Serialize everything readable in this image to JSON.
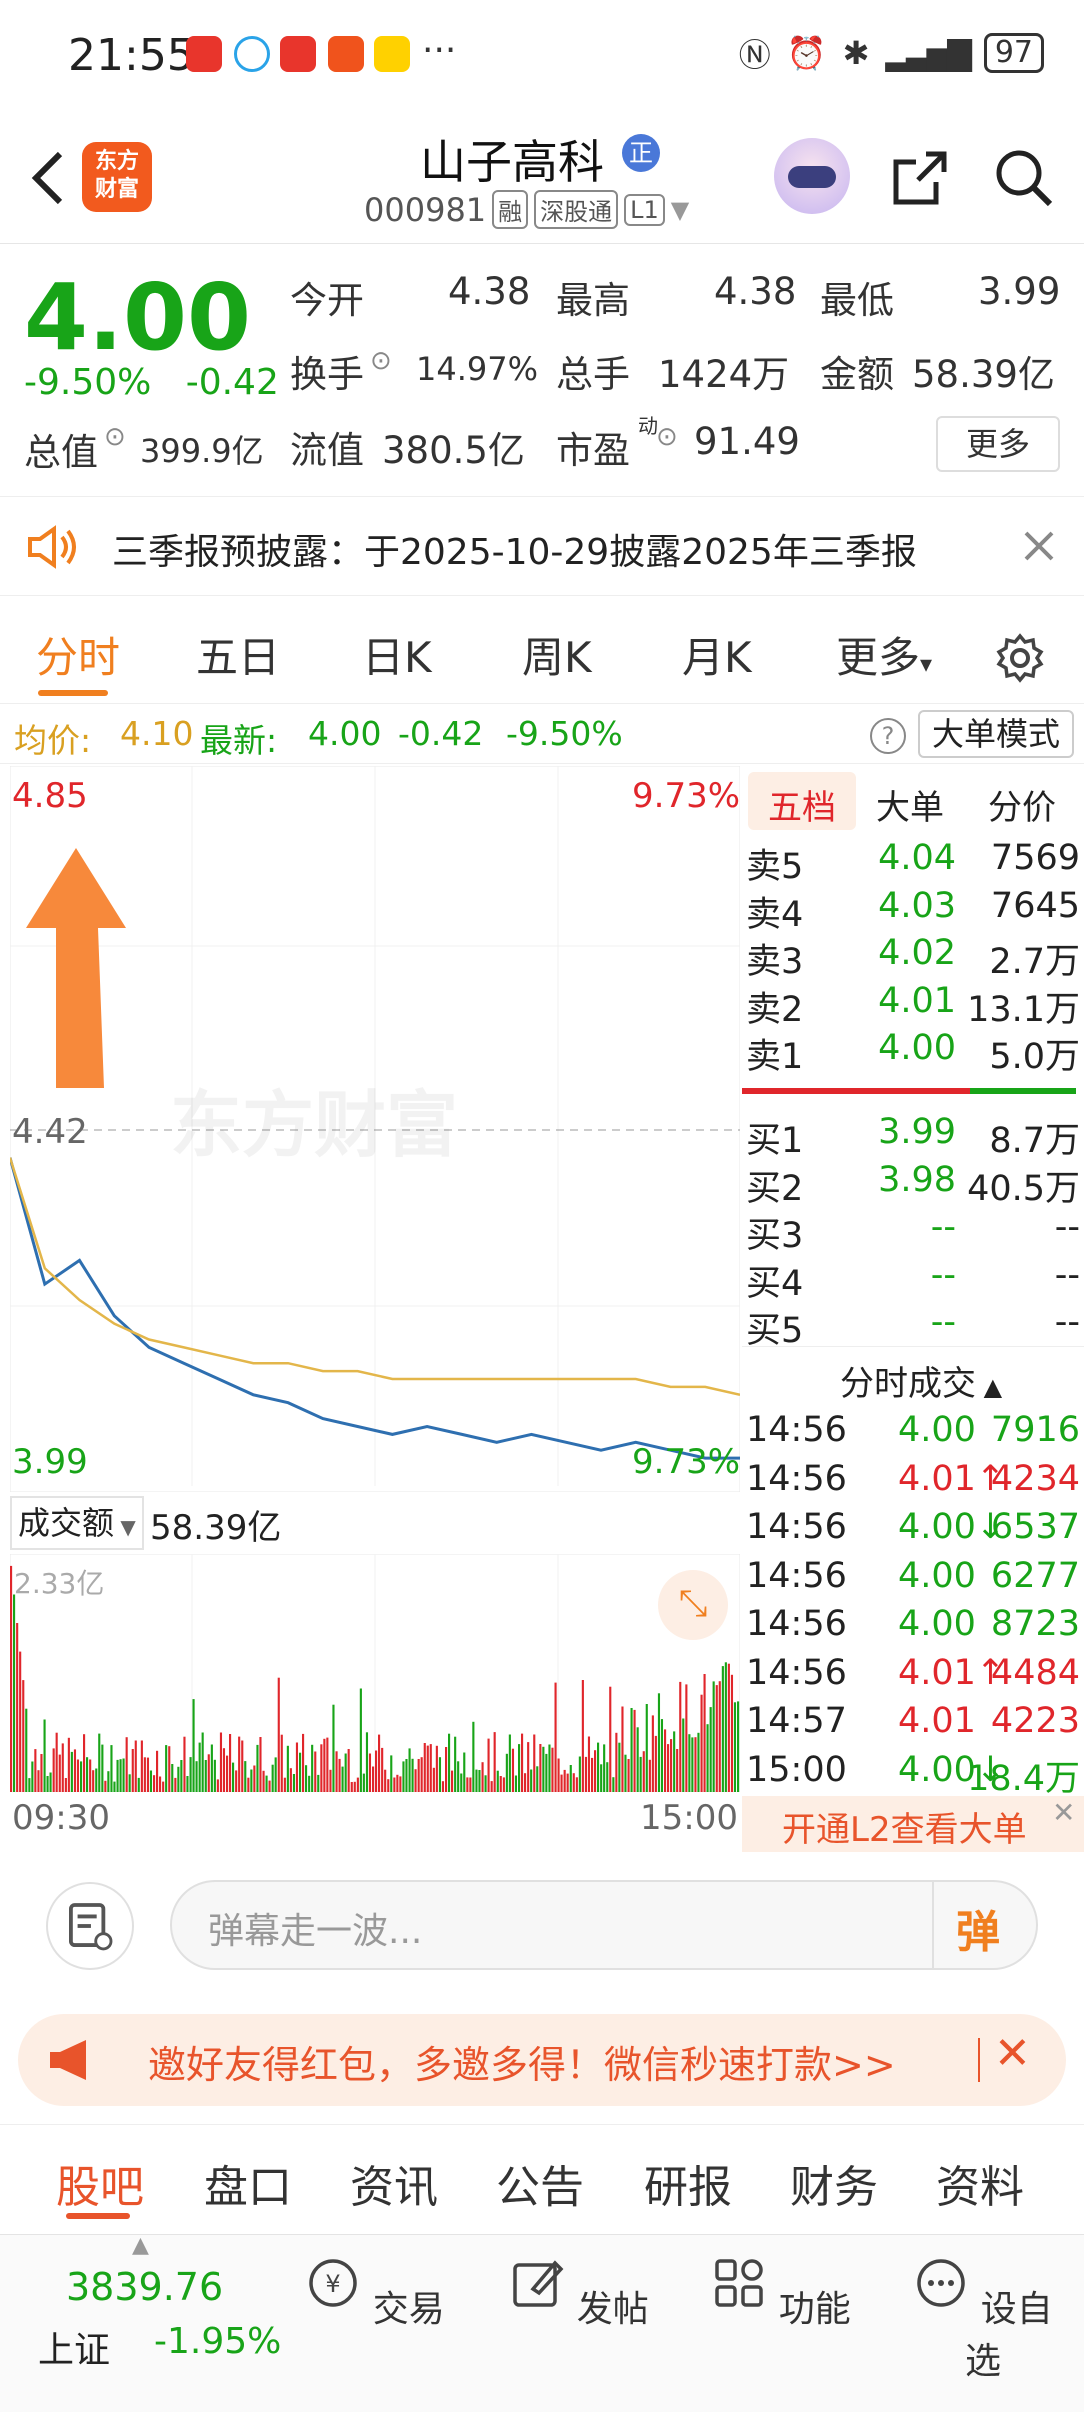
{
  "status_bar": {
    "time": "21:55",
    "more": "···",
    "battery": "97"
  },
  "header": {
    "title": "山子高科",
    "title_badge": "正",
    "code": "000981",
    "tags": [
      "融",
      "深股通",
      "L1"
    ],
    "logo_line1": "东方",
    "logo_line2": "财富"
  },
  "quote": {
    "price": "4.00",
    "change_pct": "-9.50%",
    "change": "-0.42",
    "open_label": "今开",
    "open": "4.38",
    "high_label": "最高",
    "high": "4.38",
    "low_label": "最低",
    "low": "3.99",
    "turnover_label": "换手",
    "turnover": "14.97%",
    "volume_label": "总手",
    "volume": "1424万",
    "amount_label": "金额",
    "amount": "58.39亿",
    "mcap_label": "总值",
    "mcap": "399.9亿",
    "float_label": "流值",
    "float": "380.5亿",
    "pe_label": "市盈",
    "pe_sup": "动",
    "pe": "91.49",
    "more_button": "更多"
  },
  "notice": {
    "text": "三季报预披露：于2025-10-29披露2025年三季报"
  },
  "tabs": [
    "分时",
    "五日",
    "日K",
    "周K",
    "月K",
    "更多"
  ],
  "avg_row": {
    "avg_label": "均价:",
    "avg": "4.10",
    "latest_label": "最新:",
    "latest": "4.00",
    "latest_chg": "-0.42",
    "latest_pct": "-9.50%",
    "mode_button": "大单模式"
  },
  "chart": {
    "top_price": "4.85",
    "top_pct": "9.73%",
    "mid_price": "4.42",
    "bottom_price": "3.99",
    "bottom_pct": "9.73%",
    "watermark": "东方财富",
    "volume_label": "成交额",
    "volume_value": "58.39亿",
    "volume_max": "2.33亿",
    "time_start": "09:30",
    "time_end": "15:00"
  },
  "chart_data": {
    "type": "line",
    "title": "",
    "xlabel": "",
    "ylabel": "",
    "ylim": [
      3.99,
      4.85
    ],
    "reference": 4.42,
    "series": [
      {
        "values": [
          4.38,
          4.22,
          4.25,
          4.18,
          4.14,
          4.12,
          4.1,
          4.08,
          4.07,
          4.05,
          4.04,
          4.03,
          4.04,
          4.03,
          4.02,
          4.03,
          4.02,
          4.01,
          4.02,
          4.01,
          4.0,
          4.0
        ]
      },
      {
        "values": [
          4.38,
          4.24,
          4.2,
          4.17,
          4.15,
          4.14,
          4.13,
          4.12,
          4.12,
          4.11,
          4.11,
          4.1,
          4.1,
          4.1,
          4.1,
          4.1,
          4.1,
          4.1,
          4.1,
          4.09,
          4.09,
          4.08
        ]
      }
    ]
  },
  "orderbook": {
    "tabs": [
      "五档",
      "大单",
      "分价"
    ],
    "asks": [
      {
        "label": "卖5",
        "price": "4.04",
        "vol": "7569"
      },
      {
        "label": "卖4",
        "price": "4.03",
        "vol": "7645"
      },
      {
        "label": "卖3",
        "price": "4.02",
        "vol": "2.7万"
      },
      {
        "label": "卖2",
        "price": "4.01",
        "vol": "13.1万"
      },
      {
        "label": "卖1",
        "price": "4.00",
        "vol": "5.0万"
      }
    ],
    "bids": [
      {
        "label": "买1",
        "price": "3.99",
        "vol": "8.7万"
      },
      {
        "label": "买2",
        "price": "3.98",
        "vol": "40.5万"
      },
      {
        "label": "买3",
        "price": "--",
        "vol": "--"
      },
      {
        "label": "买4",
        "price": "--",
        "vol": "--"
      },
      {
        "label": "买5",
        "price": "--",
        "vol": "--"
      }
    ],
    "trades_title": "分时成交",
    "trades": [
      {
        "time": "14:56",
        "price": "4.00",
        "vol": "7916",
        "dir": "",
        "color": "green"
      },
      {
        "time": "14:56",
        "price": "4.01",
        "vol": "4234",
        "dir": "↑",
        "color": "red"
      },
      {
        "time": "14:56",
        "price": "4.00",
        "vol": "6537",
        "dir": "↓",
        "color": "green"
      },
      {
        "time": "14:56",
        "price": "4.00",
        "vol": "6277",
        "dir": "",
        "color": "green"
      },
      {
        "time": "14:56",
        "price": "4.00",
        "vol": "8723",
        "dir": "",
        "color": "green"
      },
      {
        "time": "14:56",
        "price": "4.01",
        "vol": "4484",
        "dir": "↑",
        "color": "red"
      },
      {
        "time": "14:57",
        "price": "4.01",
        "vol": "4223",
        "dir": "",
        "color": "red"
      },
      {
        "time": "15:00",
        "price": "4.00",
        "vol": "18.4万",
        "dir": "↓",
        "color": "green"
      }
    ],
    "l2_banner": "开通L2查看大单"
  },
  "comment": {
    "placeholder": "弹幕走一波...",
    "send_label": "弹"
  },
  "promo": {
    "text": "邀好友得红包，多邀多得！微信秒速打款>>"
  },
  "lower_tabs": [
    "股吧",
    "盘口",
    "资讯",
    "公告",
    "研报",
    "财务",
    "资料"
  ],
  "bottom_nav": {
    "index_value": "3839.76",
    "index_name": "上证",
    "index_pct": "-1.95%",
    "items": [
      "交易",
      "发帖",
      "功能",
      "设自选"
    ]
  },
  "colors": {
    "up": "#e0262b",
    "down": "#18a418",
    "accent": "#f07f1f",
    "price_line": "#2e6fb0",
    "avg_line": "#e3b64a"
  }
}
